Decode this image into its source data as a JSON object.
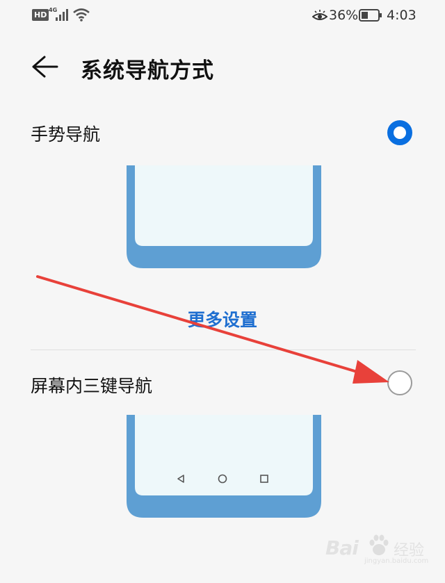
{
  "status_bar": {
    "hd_badge": "HD",
    "network_type": "4G",
    "battery_percent": "36%",
    "time": "4:03",
    "icons": [
      "signal-icon",
      "wifi-icon",
      "eye-comfort-icon",
      "battery-icon"
    ]
  },
  "header": {
    "title": "系统导航方式",
    "back_icon": "arrow-left-icon"
  },
  "options": [
    {
      "label": "手势导航",
      "selected": true
    },
    {
      "label": "屏幕内三键导航",
      "selected": false
    }
  ],
  "more_settings_label": "更多设置",
  "three_key_icons": [
    "triangle-back-icon",
    "circle-home-icon",
    "square-recent-icon"
  ],
  "annotation": {
    "type": "red-arrow",
    "points_to": "屏幕内三键导航 radio",
    "color": "#e8413a"
  },
  "watermark": {
    "brand": "Bai",
    "brand_suffix": "经验",
    "url": "jingyan.baidu.com"
  },
  "colors": {
    "accent": "#0a6fe0",
    "link": "#1f6fd0",
    "phone_frame": "#5e9fd3",
    "phone_screen": "#eef8fa",
    "arrow": "#e8413a"
  }
}
